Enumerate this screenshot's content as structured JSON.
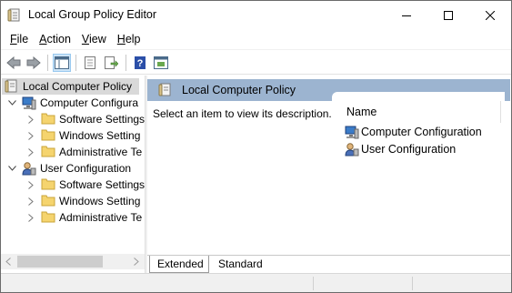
{
  "window": {
    "title": "Local Group Policy Editor",
    "controls": [
      "minimize",
      "maximize",
      "close"
    ]
  },
  "menu": {
    "items": [
      {
        "label": "File",
        "accel": "F",
        "rest": "ile"
      },
      {
        "label": "Action",
        "accel": "A",
        "rest": "ction"
      },
      {
        "label": "View",
        "accel": "V",
        "rest": "iew"
      },
      {
        "label": "Help",
        "accel": "H",
        "rest": "elp"
      }
    ]
  },
  "toolbar": {
    "buttons": [
      "back-icon",
      "forward-icon",
      "show-hide-console-tree-icon",
      "properties-icon",
      "export-list-icon",
      "help-icon",
      "show-hide-action-pane-icon"
    ]
  },
  "tree": {
    "root": {
      "label": "Local Computer Policy"
    },
    "computer": {
      "label": "Computer Configura"
    },
    "computer_children": [
      "Software Settings",
      "Windows Setting",
      "Administrative Te"
    ],
    "user": {
      "label": "User Configuration"
    },
    "user_children": [
      "Software Settings",
      "Windows Setting",
      "Administrative Te"
    ]
  },
  "details": {
    "header": "Local Computer Policy",
    "description": "Select an item to view its description.",
    "column": "Name",
    "items": [
      "Computer Configuration",
      "User Configuration"
    ]
  },
  "tabs": [
    {
      "label": "Extended",
      "active": true
    },
    {
      "label": "Standard",
      "active": false
    }
  ],
  "colors": {
    "header_bar": "#9cb4d0",
    "tree_selected": "#d9d9d9",
    "folder": "#e8c25b"
  }
}
